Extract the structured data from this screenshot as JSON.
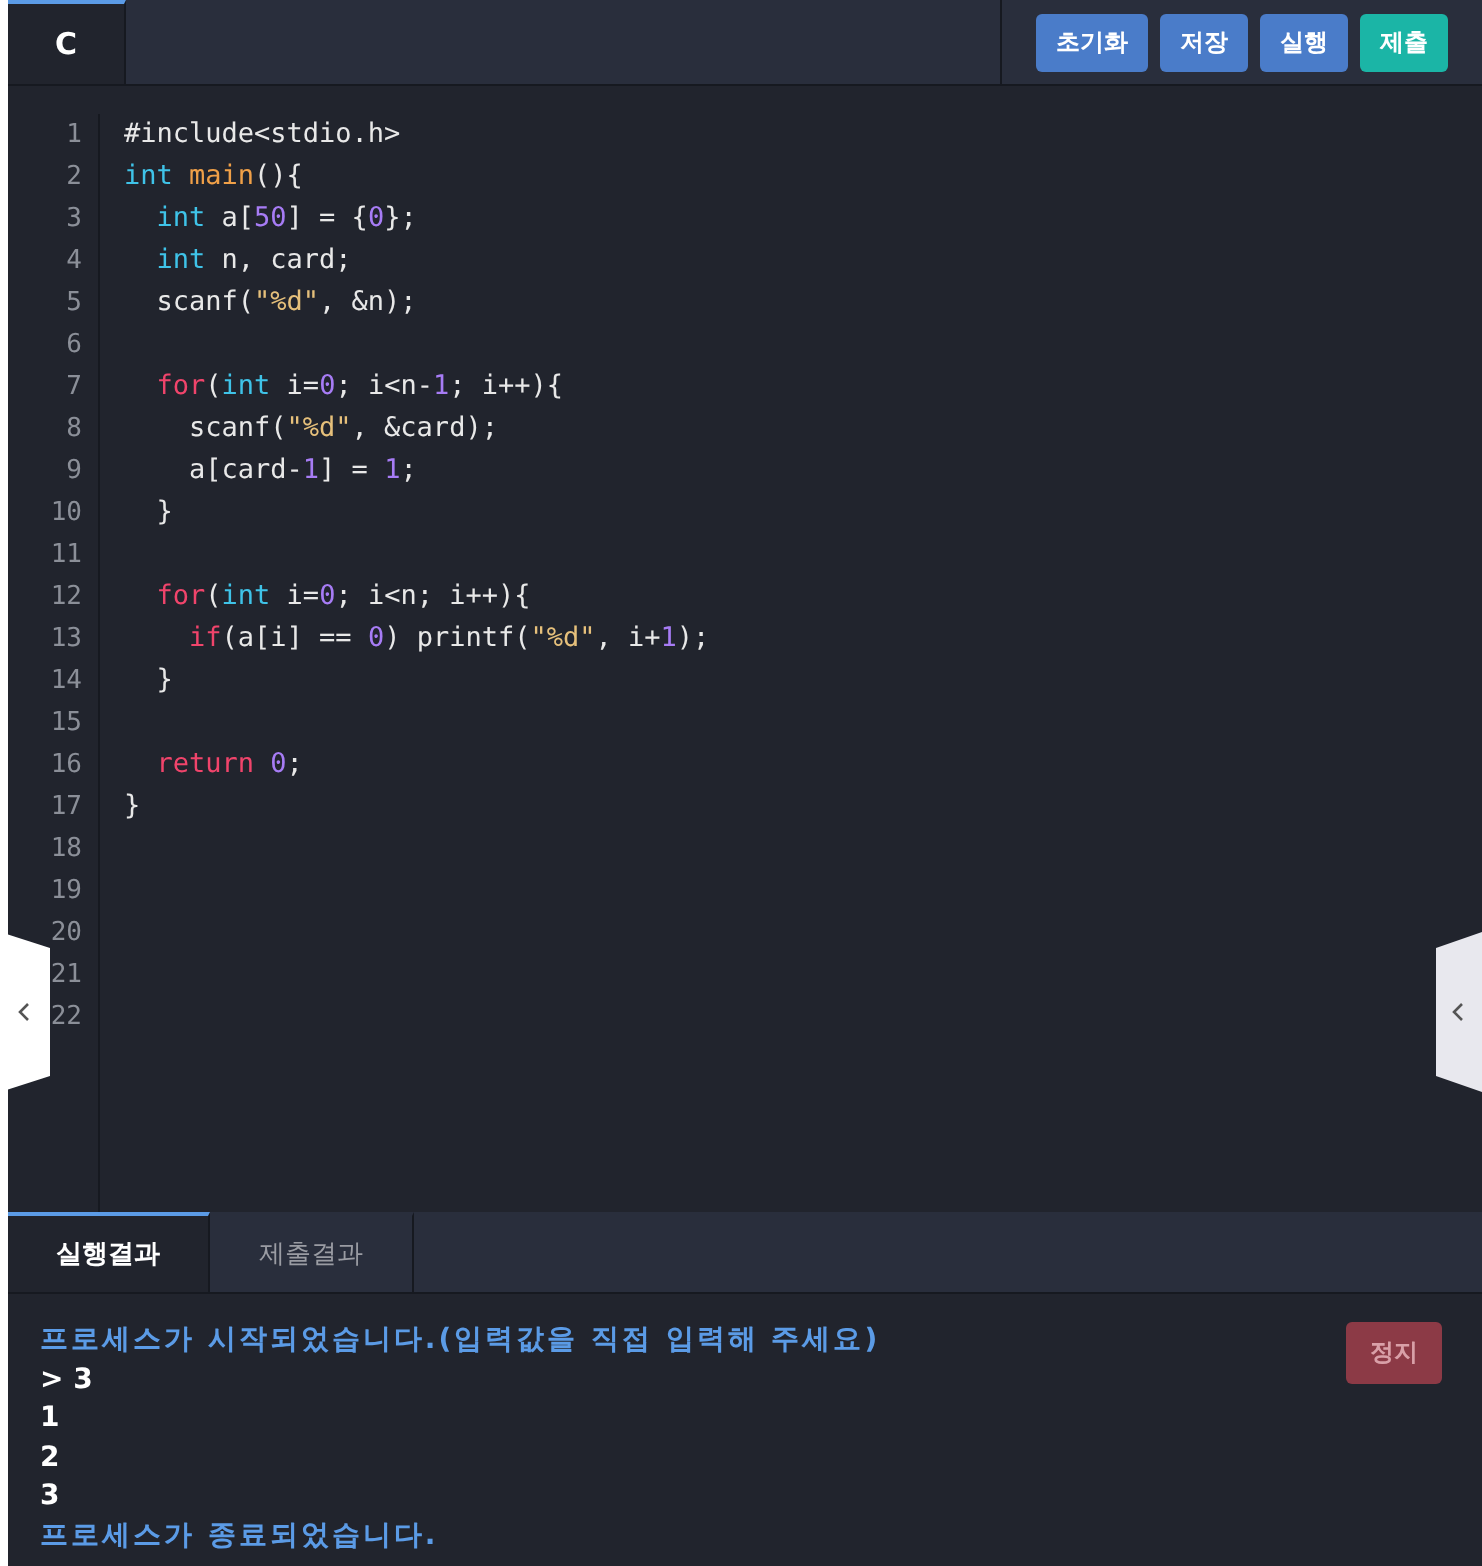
{
  "editor_tabs": [
    {
      "label": "C",
      "selected": true
    }
  ],
  "toolbar_buttons": [
    {
      "label": "초기화",
      "kind": "primary"
    },
    {
      "label": "저장",
      "kind": "primary"
    },
    {
      "label": "실행",
      "kind": "primary"
    },
    {
      "label": "제출",
      "kind": "submit"
    }
  ],
  "code_lines": [
    {
      "number": "1",
      "tokens": [
        {
          "kind": "plain",
          "text": "#include<stdio.h>"
        }
      ]
    },
    {
      "number": "2",
      "tokens": [
        {
          "kind": "type",
          "text": "int "
        },
        {
          "kind": "function",
          "text": "main"
        },
        {
          "kind": "plain",
          "text": "(){"
        }
      ]
    },
    {
      "number": "3",
      "tokens": [
        {
          "kind": "type",
          "text": "  int"
        },
        {
          "kind": "plain",
          "text": " a["
        },
        {
          "kind": "number",
          "text": "50"
        },
        {
          "kind": "plain",
          "text": "] = {"
        },
        {
          "kind": "number",
          "text": "0"
        },
        {
          "kind": "plain",
          "text": "};"
        }
      ]
    },
    {
      "number": "4",
      "tokens": [
        {
          "kind": "type",
          "text": "  int"
        },
        {
          "kind": "plain",
          "text": " n, card;"
        }
      ]
    },
    {
      "number": "5",
      "tokens": [
        {
          "kind": "plain",
          "text": "  scanf("
        },
        {
          "kind": "string",
          "text": "\"%d\""
        },
        {
          "kind": "plain",
          "text": ", &n);"
        }
      ]
    },
    {
      "number": "6"
    },
    {
      "number": "7",
      "tokens": [
        {
          "kind": "keyword",
          "text": "  for"
        },
        {
          "kind": "plain",
          "text": "("
        },
        {
          "kind": "type",
          "text": "int"
        },
        {
          "kind": "plain",
          "text": " i="
        },
        {
          "kind": "number",
          "text": "0"
        },
        {
          "kind": "plain",
          "text": "; i<n-"
        },
        {
          "kind": "number",
          "text": "1"
        },
        {
          "kind": "plain",
          "text": "; i++){"
        }
      ]
    },
    {
      "number": "8",
      "tokens": [
        {
          "kind": "plain",
          "text": "    scanf("
        },
        {
          "kind": "string",
          "text": "\"%d\""
        },
        {
          "kind": "plain",
          "text": ", &card);"
        }
      ]
    },
    {
      "number": "9",
      "tokens": [
        {
          "kind": "plain",
          "text": "    a[card-"
        },
        {
          "kind": "number",
          "text": "1"
        },
        {
          "kind": "plain",
          "text": "] = "
        },
        {
          "kind": "number",
          "text": "1"
        },
        {
          "kind": "plain",
          "text": ";"
        }
      ]
    },
    {
      "number": "10",
      "tokens": [
        {
          "kind": "plain",
          "text": "  }"
        }
      ]
    },
    {
      "number": "11"
    },
    {
      "number": "12",
      "tokens": [
        {
          "kind": "keyword",
          "text": "  for"
        },
        {
          "kind": "plain",
          "text": "("
        },
        {
          "kind": "type",
          "text": "int"
        },
        {
          "kind": "plain",
          "text": " i="
        },
        {
          "kind": "number",
          "text": "0"
        },
        {
          "kind": "plain",
          "text": "; i<n; i++){"
        }
      ]
    },
    {
      "number": "13",
      "tokens": [
        {
          "kind": "keyword",
          "text": "    if"
        },
        {
          "kind": "plain",
          "text": "(a[i] == "
        },
        {
          "kind": "number",
          "text": "0"
        },
        {
          "kind": "plain",
          "text": ") printf("
        },
        {
          "kind": "string",
          "text": "\"%d\""
        },
        {
          "kind": "plain",
          "text": ", i+"
        },
        {
          "kind": "number",
          "text": "1"
        },
        {
          "kind": "plain",
          "text": ");"
        }
      ]
    },
    {
      "number": "14",
      "tokens": [
        {
          "kind": "plain",
          "text": "  }"
        }
      ]
    },
    {
      "number": "15"
    },
    {
      "number": "16",
      "tokens": [
        {
          "kind": "keyword",
          "text": "  return"
        },
        {
          "kind": "number",
          "text": " 0"
        },
        {
          "kind": "plain",
          "text": ";"
        }
      ]
    },
    {
      "number": "17",
      "tokens": [
        {
          "kind": "plain",
          "text": "}"
        }
      ]
    },
    {
      "number": "18"
    },
    {
      "number": "19"
    },
    {
      "number": "20"
    },
    {
      "number": "21"
    },
    {
      "number": "22"
    }
  ],
  "result_tabs": [
    {
      "label": "실행결과",
      "selected": true
    },
    {
      "label": "제출결과",
      "selected": false
    }
  ],
  "stop_button": {
    "label": "정지"
  },
  "console_lines": [
    {
      "kind": "system",
      "text": "프로세스가 시작되었습니다.(입력값을 직접 입력해 주세요)"
    },
    {
      "kind": "output",
      "text": "> 3"
    },
    {
      "kind": "output",
      "text": "1"
    },
    {
      "kind": "output",
      "text": "2"
    },
    {
      "kind": "output",
      "text": "3"
    },
    {
      "kind": "system",
      "text": "프로세스가 종료되었습니다."
    }
  ]
}
